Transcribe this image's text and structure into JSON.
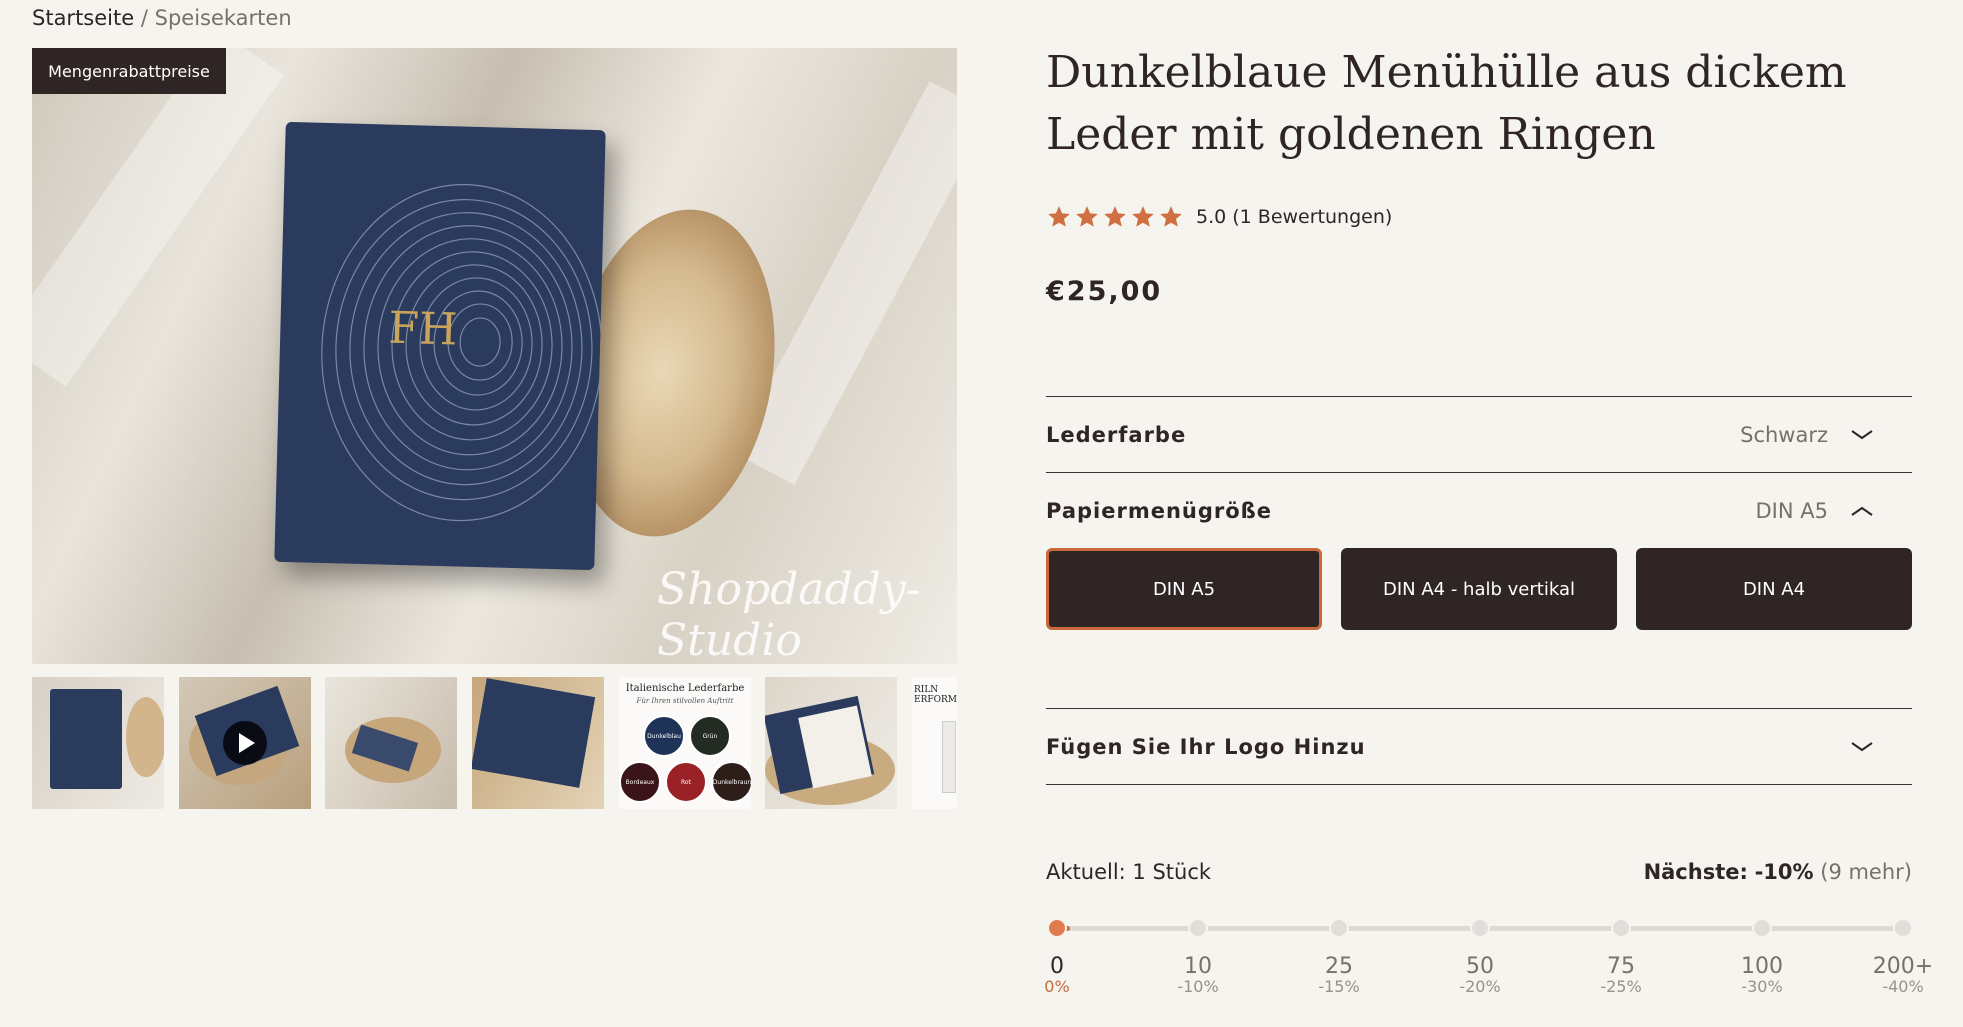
{
  "breadcrumb": {
    "home": "Startseite",
    "separator": "/",
    "current": "Speisekarten"
  },
  "gallery": {
    "badge": "Mengenrabattpreise",
    "watermark": "Shopdaddy-Studio",
    "monogram": "FH",
    "thumb5": {
      "title": "Italienische Lederfarbe",
      "subtitle": "Für Ihren stilvollen Auftritt",
      "swatches": [
        "Dunkelblau",
        "Grün",
        "Bordeaux",
        "Rot",
        "Dunkelbraun"
      ]
    },
    "thumb7_text": "RILN ERFORMA"
  },
  "product": {
    "title": "Dunkelblaue Menühülle aus dickem Leder mit goldenen Ringen",
    "rating_text": "5.0 (1 Bewertungen)",
    "rating": 5,
    "price": "€25,00"
  },
  "options": {
    "leather": {
      "label": "Lederfarbe",
      "value": "Schwarz"
    },
    "paper": {
      "label": "Papiermenügröße",
      "value": "DIN A5",
      "buttons": [
        "DIN A5",
        "DIN A4 - halb vertikal",
        "DIN A4"
      ],
      "selected": "DIN A5"
    },
    "logo": {
      "label": "Fügen Sie Ihr Logo Hinzu"
    }
  },
  "quantity": {
    "current_label": "Aktuell:",
    "current_value": "1 Stück",
    "next_label": "Nächste:",
    "next_value": "-10%",
    "next_more": "(9 mehr)",
    "ticks": [
      {
        "q": "0",
        "d": "0%"
      },
      {
        "q": "10",
        "d": "-10%"
      },
      {
        "q": "25",
        "d": "-15%"
      },
      {
        "q": "50",
        "d": "-20%"
      },
      {
        "q": "75",
        "d": "-25%"
      },
      {
        "q": "100",
        "d": "-30%"
      },
      {
        "q": "200+",
        "d": "-40%"
      }
    ]
  },
  "colors": {
    "accent": "#c8693e",
    "dark": "#2f2525",
    "background": "#f6f4ef",
    "star": "#d07042"
  }
}
